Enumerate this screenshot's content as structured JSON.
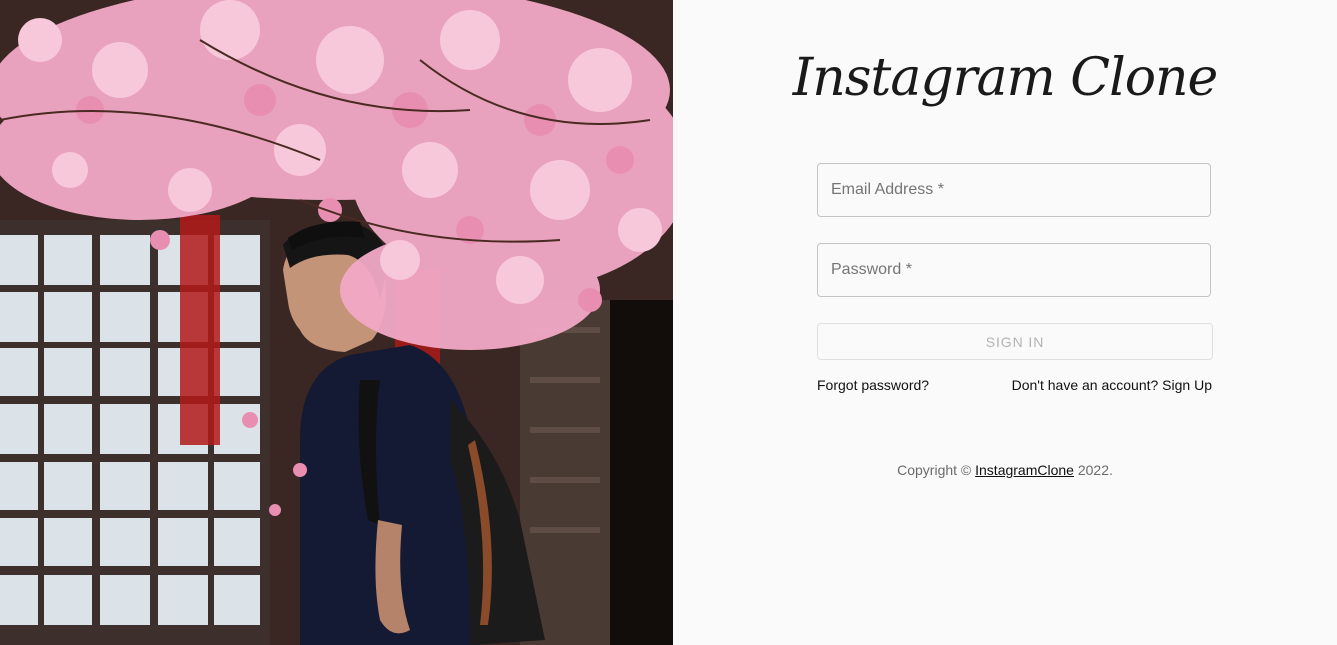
{
  "login": {
    "logo_text": "Instagram Clone",
    "email_placeholder": "Email Address *",
    "password_placeholder": "Password *",
    "signin_label": "SIGN IN",
    "forgot_link": "Forgot password?",
    "signup_link": "Don't have an account? Sign Up",
    "copyright_prefix": "Copyright ©",
    "copyright_link": "InstagramClone",
    "copyright_suffix": "2022."
  },
  "colors": {
    "background": "#fafafa",
    "border": "#c4c4c4",
    "disabled_text": "#b3b3b3",
    "blossom_pink": "#f2a9c6"
  }
}
